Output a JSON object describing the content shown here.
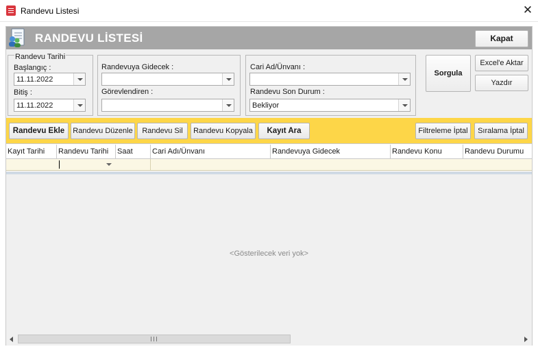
{
  "window": {
    "title": "Randevu Listesi",
    "close_glyph": "✕"
  },
  "header": {
    "title": "RANDEVU LİSTESİ",
    "icon": "document-people-icon",
    "close_button": "Kapat"
  },
  "filters": {
    "date_group": {
      "legend": "Randevu Tarihi",
      "start_label": "Başlangıç :",
      "start_value": "11.11.2022",
      "end_label": "Bitiş :",
      "end_value": "11.11.2022"
    },
    "assignee_group": {
      "attendee_label": "Randevuya Gidecek :",
      "attendee_value": "",
      "assigner_label": "Görevlendiren :",
      "assigner_value": ""
    },
    "customer_group": {
      "customer_label": "Cari Ad/Ünvanı :",
      "customer_value": "",
      "status_label": "Randevu Son Durum :",
      "status_value": "Bekliyor"
    },
    "query_button": "Sorgula",
    "excel_button": "Excel'e Aktar",
    "print_button": "Yazdır"
  },
  "toolbar": {
    "add": "Randevu Ekle",
    "edit": "Randevu Düzenle",
    "delete": "Randevu Sil",
    "copy": "Randevu Kopyala",
    "save": "Kayıt Ara",
    "clear_filter": "Filtreleme İptal",
    "clear_sort": "Sıralama İptal"
  },
  "grid": {
    "columns": [
      "Kayıt Tarihi",
      "Randevu Tarihi",
      "Saat",
      "Cari Adı/Ünvanı",
      "Randevuya Gidecek",
      "Randevu Konu",
      "Randevu Durumu"
    ],
    "empty_message": "<Gösterilecek veri yok>"
  },
  "colors": {
    "header_band": "#a6a6a6",
    "toolbar_band": "#fdd648",
    "accent_icon": "#d9363e"
  }
}
